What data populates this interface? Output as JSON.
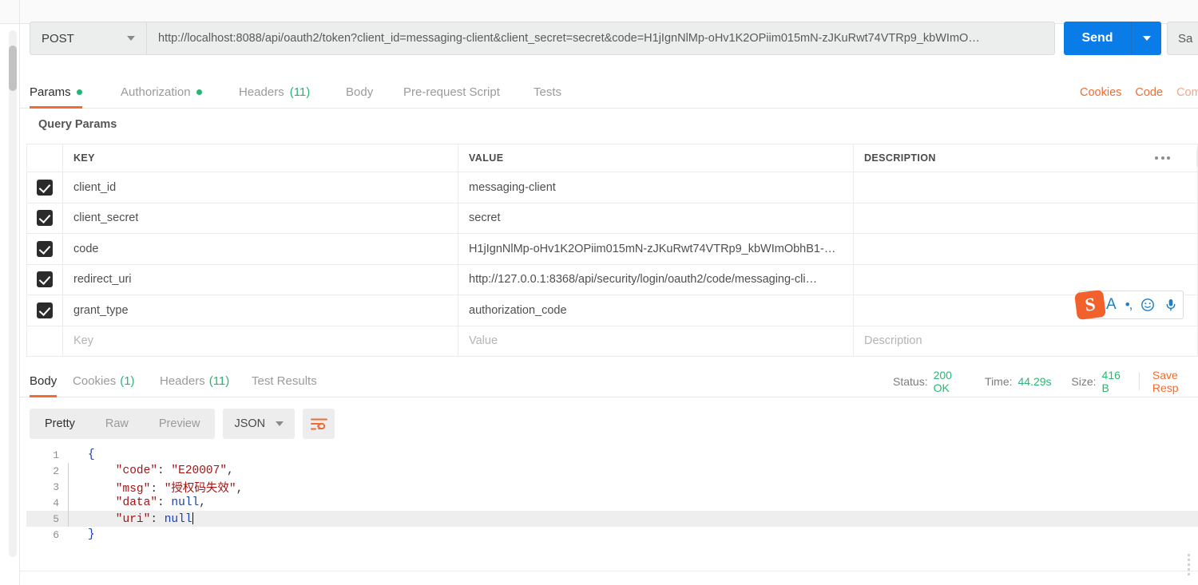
{
  "request": {
    "method": "POST",
    "method_icon": "chevron-down-icon",
    "url": "http://localhost:8088/api/oauth2/token?client_id=messaging-client&client_secret=secret&code=H1jIgnNlMp-oHv1K2OPiim015mN-zJKuRwt74VTRp9_kbWImO…",
    "send_label": "Send",
    "send_caret_icon": "chevron-down-icon",
    "save_label": "Sa"
  },
  "request_tabs": [
    {
      "label": "Params",
      "badge_dot": true,
      "active": true
    },
    {
      "label": "Authorization",
      "badge_dot": true,
      "active": false
    },
    {
      "label": "Headers",
      "count": "(11)",
      "active": false
    },
    {
      "label": "Body",
      "active": false
    },
    {
      "label": "Pre-request Script",
      "active": false
    },
    {
      "label": "Tests",
      "active": false
    }
  ],
  "request_links": [
    {
      "label": "Cookies",
      "faded": false
    },
    {
      "label": "Code",
      "faded": false
    },
    {
      "label": "Com",
      "faded": true
    }
  ],
  "query_params": {
    "section_title": "Query Params",
    "columns": [
      "KEY",
      "VALUE",
      "DESCRIPTION"
    ],
    "more_icon": "ellipsis-icon",
    "rows": [
      {
        "checked": true,
        "key": "client_id",
        "value": "messaging-client",
        "description": ""
      },
      {
        "checked": true,
        "key": "client_secret",
        "value": "secret",
        "description": ""
      },
      {
        "checked": true,
        "key": "code",
        "value": "H1jIgnNlMp-oHv1K2OPiim015mN-zJKuRwt74VTRp9_kbWImObhB1-…",
        "description": ""
      },
      {
        "checked": true,
        "key": "redirect_uri",
        "value": "http://127.0.0.1:8368/api/security/login/oauth2/code/messaging-cli…",
        "description": ""
      },
      {
        "checked": true,
        "key": "grant_type",
        "value": "authorization_code",
        "description": ""
      }
    ],
    "empty_row": {
      "key_placeholder": "Key",
      "value_placeholder": "Value",
      "description_placeholder": "Description"
    }
  },
  "ime_toolbar": {
    "logo_text": "S",
    "items": [
      "sogou-logo-icon",
      "letter-a-icon",
      "punctuation-icon",
      "emoji-icon",
      "microphone-icon"
    ]
  },
  "response_tabs": [
    {
      "label": "Body",
      "active": true
    },
    {
      "label": "Cookies",
      "count": "(1)",
      "active": false
    },
    {
      "label": "Headers",
      "count": "(11)",
      "active": false
    },
    {
      "label": "Test Results",
      "active": false
    }
  ],
  "response_status": {
    "status_label": "Status:",
    "status_value": "200 OK",
    "time_label": "Time:",
    "time_value": "44.29s",
    "size_label": "Size:",
    "size_value": "416 B",
    "save_response_label": "Save Resp"
  },
  "body_toolbar": {
    "views": [
      {
        "label": "Pretty",
        "active": true
      },
      {
        "label": "Raw",
        "active": false
      },
      {
        "label": "Preview",
        "active": false
      }
    ],
    "format": "JSON",
    "format_caret_icon": "chevron-down-icon",
    "wrap_icon": "word-wrap-icon"
  },
  "response_body": {
    "lines": [
      {
        "num": "1",
        "segments": [
          {
            "t": "{",
            "c": "k-brace"
          }
        ],
        "highlight": false,
        "fold": false
      },
      {
        "num": "2",
        "segments": [
          {
            "t": "    \"code\"",
            "c": "k-key"
          },
          {
            "t": ": ",
            "c": "k-punc"
          },
          {
            "t": "\"E20007\"",
            "c": "k-str"
          },
          {
            "t": ",",
            "c": "k-punc"
          }
        ],
        "highlight": false,
        "fold": true
      },
      {
        "num": "3",
        "segments": [
          {
            "t": "    \"msg\"",
            "c": "k-key"
          },
          {
            "t": ": ",
            "c": "k-punc"
          },
          {
            "t": "\"授权码失效\"",
            "c": "k-str"
          },
          {
            "t": ",",
            "c": "k-punc"
          }
        ],
        "highlight": false,
        "fold": true
      },
      {
        "num": "4",
        "segments": [
          {
            "t": "    \"data\"",
            "c": "k-key"
          },
          {
            "t": ": ",
            "c": "k-punc"
          },
          {
            "t": "null",
            "c": "k-null"
          },
          {
            "t": ",",
            "c": "k-punc"
          }
        ],
        "highlight": false,
        "fold": true
      },
      {
        "num": "5",
        "segments": [
          {
            "t": "    \"uri\"",
            "c": "k-key"
          },
          {
            "t": ": ",
            "c": "k-punc"
          },
          {
            "t": "null",
            "c": "k-null"
          }
        ],
        "highlight": true,
        "fold": true,
        "caret": true
      },
      {
        "num": "6",
        "segments": [
          {
            "t": "}",
            "c": "k-brace"
          }
        ],
        "highlight": false,
        "fold": false
      }
    ]
  },
  "colors": {
    "accent_orange": "#ef6c35",
    "send_blue": "#0a7ce8",
    "status_green": "#2bb673",
    "checkbox_dark": "#2b2b2b"
  }
}
